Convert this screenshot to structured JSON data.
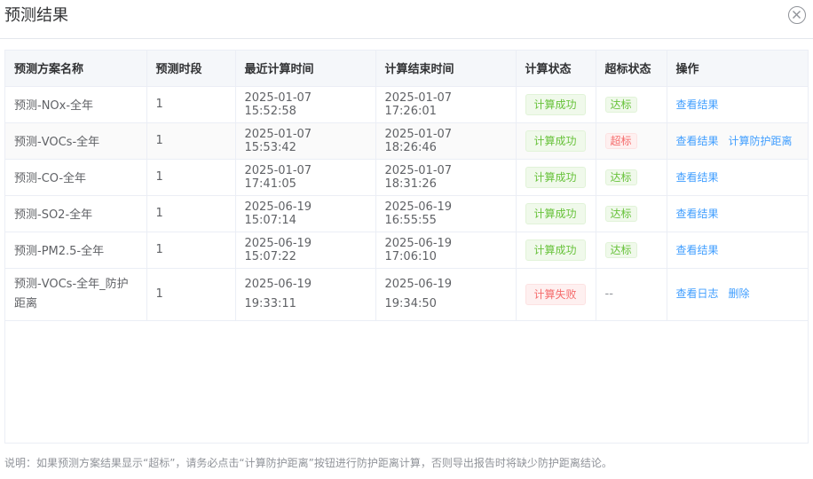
{
  "dialog": {
    "title": "预测结果",
    "close_icon": "close-circle-icon"
  },
  "table": {
    "columns": [
      "预测方案名称",
      "预测时段",
      "最近计算时间",
      "计算结束时间",
      "计算状态",
      "超标状态",
      "操作"
    ],
    "rows": [
      {
        "name": "预测-NOx-全年",
        "period": "1",
        "last_calc": "2025-01-07 15:52:58",
        "end_time": "2025-01-07 17:26:01",
        "calc_status": "计算成功",
        "calc_status_type": "success",
        "exceed_status": "达标",
        "exceed_type": "success",
        "actions": [
          "查看结果"
        ]
      },
      {
        "name": "预测-VOCs-全年",
        "period": "1",
        "last_calc": "2025-01-07 15:53:42",
        "end_time": "2025-01-07 18:26:46",
        "calc_status": "计算成功",
        "calc_status_type": "success",
        "exceed_status": "超标",
        "exceed_type": "danger",
        "actions": [
          "查看结果",
          "计算防护距离"
        ]
      },
      {
        "name": "预测-CO-全年",
        "period": "1",
        "last_calc": "2025-01-07 17:41:05",
        "end_time": "2025-01-07 18:31:26",
        "calc_status": "计算成功",
        "calc_status_type": "success",
        "exceed_status": "达标",
        "exceed_type": "success",
        "actions": [
          "查看结果"
        ]
      },
      {
        "name": "预测-SO2-全年",
        "period": "1",
        "last_calc": "2025-06-19 15:07:14",
        "end_time": "2025-06-19 16:55:55",
        "calc_status": "计算成功",
        "calc_status_type": "success",
        "exceed_status": "达标",
        "exceed_type": "success",
        "actions": [
          "查看结果"
        ]
      },
      {
        "name": "预测-PM2.5-全年",
        "period": "1",
        "last_calc": "2025-06-19 15:07:22",
        "end_time": "2025-06-19 17:06:10",
        "calc_status": "计算成功",
        "calc_status_type": "success",
        "exceed_status": "达标",
        "exceed_type": "success",
        "actions": [
          "查看结果"
        ]
      },
      {
        "name": "预测-VOCs-全年_防护距离",
        "period": "1",
        "last_calc": "2025-06-19 19:33:11",
        "end_time": "2025-06-19 19:34:50",
        "calc_status": "计算失败",
        "calc_status_type": "danger",
        "exceed_status": "--",
        "exceed_type": "none",
        "actions": [
          "查看日志",
          "删除"
        ]
      }
    ]
  },
  "note": "说明：如果预测方案结果显示“超标”，请务必点击“计算防护距离”按钮进行防护距离计算，否则导出报告时将缺少防护距离结论。",
  "colors": {
    "success": "#67c23a",
    "danger": "#f56c6c",
    "link": "#409eff"
  }
}
